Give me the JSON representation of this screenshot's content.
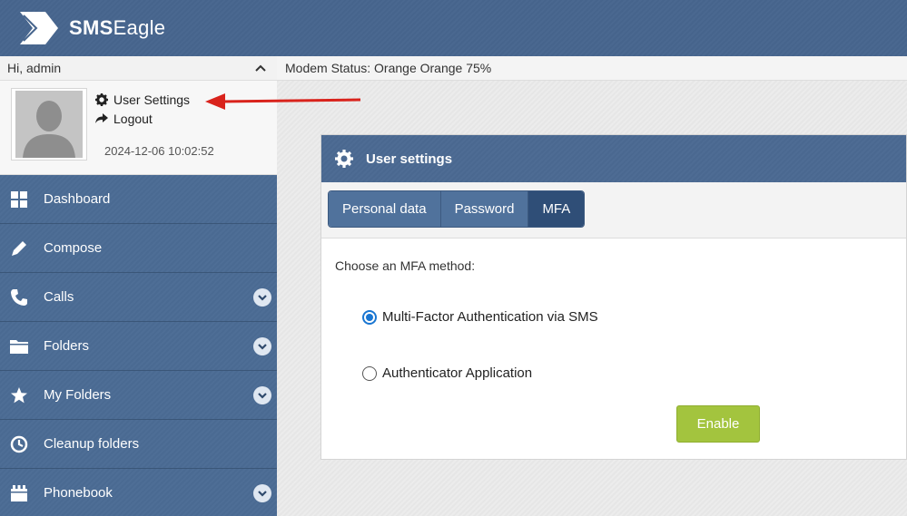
{
  "header": {
    "logo_bold": "SMS",
    "logo_light": "Eagle"
  },
  "sidebar": {
    "greeting": "Hi, admin",
    "profile": {
      "user_settings": "User Settings",
      "logout": "Logout",
      "timestamp": "2024-12-06 10:02:52"
    },
    "items": [
      {
        "label": "Dashboard",
        "icon": "dashboard-icon",
        "expandable": false
      },
      {
        "label": "Compose",
        "icon": "pencil-icon",
        "expandable": false
      },
      {
        "label": "Calls",
        "icon": "phone-icon",
        "expandable": true
      },
      {
        "label": "Folders",
        "icon": "folder-icon",
        "expandable": true
      },
      {
        "label": "My Folders",
        "icon": "star-icon",
        "expandable": true
      },
      {
        "label": "Cleanup folders",
        "icon": "clock-icon",
        "expandable": false
      },
      {
        "label": "Phonebook",
        "icon": "phonebook-icon",
        "expandable": true
      }
    ]
  },
  "status": {
    "text": "Modem Status: Orange Orange 75%"
  },
  "panel": {
    "title": "User settings",
    "tabs": [
      {
        "label": "Personal data",
        "active": false
      },
      {
        "label": "Password",
        "active": false
      },
      {
        "label": "MFA",
        "active": true
      }
    ],
    "prompt": "Choose an MFA method:",
    "options": [
      {
        "label": "Multi-Factor Authentication via SMS",
        "checked": true
      },
      {
        "label": "Authenticator Application",
        "checked": false
      }
    ],
    "enable_label": "Enable"
  },
  "colors": {
    "accent_green": "#a3c43e",
    "header_blue": "#46648c",
    "radio_blue": "#1976d2",
    "arrow_red": "#d9231c"
  }
}
